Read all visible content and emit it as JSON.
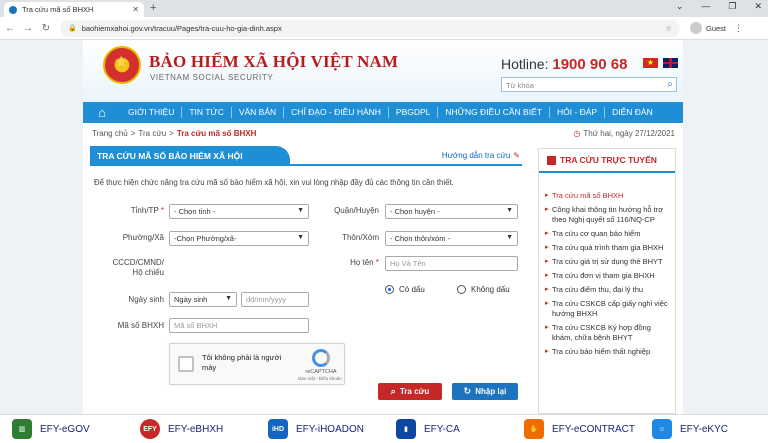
{
  "browser": {
    "tab_title": "Tra cứu mã số BHXH",
    "url": "baohiemxahoi.gov.vn/tracuu/Pages/tra-cuu-ho-gia-dinh.aspx",
    "profile": "Guest"
  },
  "header": {
    "org_name": "BẢO HIỂM XÃ HỘI VIỆT NAM",
    "org_sub": "VIETNAM SOCIAL SECURITY",
    "hotline_label": "Hotline:",
    "hotline_number": "1900 90 68",
    "search_placeholder": "Từ khóa"
  },
  "nav": [
    "GIỚI THIỆU",
    "TIN TỨC",
    "VĂN BẢN",
    "CHỈ ĐẠO - ĐIỀU HÀNH",
    "PBGDPL",
    "NHỮNG ĐIỀU CẦN BIẾT",
    "HỎI - ĐÁP",
    "DIỄN ĐÀN"
  ],
  "breadcrumb": {
    "home": "Trang chủ",
    "level1": "Tra cứu",
    "current": "Tra cứu mã số BHXH",
    "sep": ">"
  },
  "date": "Thứ hai, ngày 27/12/2021",
  "panel": {
    "title": "TRA CỨU MÃ SỐ BẢO HIỂM XÃ HỘI",
    "guide": "Hướng dẫn tra cứu",
    "intro": "Để thực hiện chức năng tra cứu mã số bảo hiểm xã hội, xin vui lòng nhập đầy đủ các thông tin cần thiết."
  },
  "form": {
    "province_label": "Tỉnh/TP",
    "province_value": "- Chọn tỉnh -",
    "district_label": "Quận/Huyện",
    "district_value": "- Chọn huyện -",
    "ward_label": "Phường/Xã",
    "ward_value": "-Chọn Phường/xã-",
    "hamlet_label": "Thôn/Xóm",
    "hamlet_value": "- Chọn thôn/xóm -",
    "id_label_1": "CCCD/CMND/",
    "id_label_2": "Hộ chiếu",
    "name_label": "Họ tên",
    "name_placeholder": "Họ Và Tên",
    "accent_yes": "Có dấu",
    "accent_no": "Không dấu",
    "dob_label": "Ngày sinh",
    "dob_type": "Ngày sinh",
    "dob_placeholder": "dd/mm/yyyy",
    "bhxh_label": "Mã số BHXH",
    "bhxh_placeholder": "Mã số BHXH",
    "required_mark": "*"
  },
  "captcha": {
    "text": "Tôi không phải là người máy",
    "brand": "reCAPTCHA",
    "terms": "Bảo mật - Điều khoản"
  },
  "buttons": {
    "search": "Tra cứu",
    "reset": "Nhập lại"
  },
  "sidebar": {
    "title": "TRA CỨU TRỰC TUYẾN",
    "items": [
      "Tra cứu mã số BHXH",
      "Công khai thông tin hướng hỗ trợ theo Nghị quyết số 116/NQ-CP",
      "Tra cứu cơ quan bảo hiểm",
      "Tra cứu quá trình tham gia BHXH",
      "Tra cứu giá trị sử dụng thẻ BHYT",
      "Tra cứu đơn vị tham gia BHXH",
      "Tra cứu điểm thu, đại lý thu",
      "Tra cứu CSKCB cấp giấy nghỉ việc hưởng BHXH",
      "Tra cứu CSKCB Ký hợp đồng khám, chữa bệnh BHYT",
      "Tra cứu bảo hiểm thất nghiệp"
    ]
  },
  "banner": [
    {
      "label": "EFY-eGOV",
      "color": "#2e7d32",
      "icon": "building-icon"
    },
    {
      "label": "EFY-eBHXH",
      "color": "#c62828",
      "icon": "efy-logo-icon"
    },
    {
      "label": "EFY-iHOADON",
      "color": "#1565c0",
      "icon": "ihd-logo-icon"
    },
    {
      "label": "EFY-CA",
      "color": "#0d47a1",
      "icon": "usb-token-icon"
    },
    {
      "label": "EFY-eCONTRACT",
      "color": "#ef6c00",
      "icon": "handshake-icon"
    },
    {
      "label": "EFY-eKYC",
      "color": "#1e88e5",
      "icon": "face-scan-icon"
    }
  ]
}
